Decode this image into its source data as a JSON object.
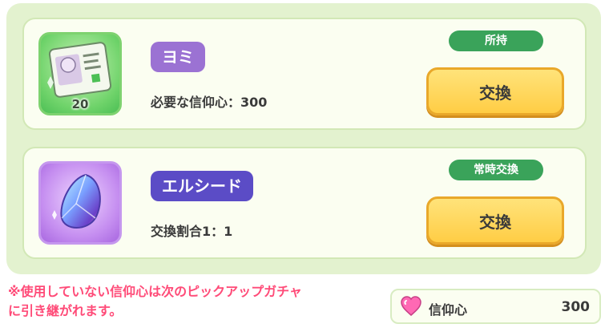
{
  "items": [
    {
      "name": "ヨミ",
      "requirement": "必要な信仰心：300",
      "count": "20",
      "status": "所持",
      "exchange_label": "交換",
      "icon": "character-ticket-icon"
    },
    {
      "name": "エルシード",
      "requirement": "交換割合1：1",
      "status": "常時交換",
      "exchange_label": "交換",
      "icon": "crystal-gem-icon"
    }
  ],
  "note": {
    "line1": "※使用していない信仰心は次のピックアップガチャ",
    "line2": "に引き継がれます。"
  },
  "currency": {
    "label": "信仰心",
    "amount": "300",
    "icon": "heart-icon"
  },
  "colors": {
    "panel": "#e3f2cf",
    "card": "#fbfef1",
    "status_green": "#3aa35a",
    "button_yellow": "#ffcd45",
    "note_pink": "#ff4b78",
    "badge_purple": "#9b72d3",
    "badge_indigo": "#5b4cc6"
  }
}
